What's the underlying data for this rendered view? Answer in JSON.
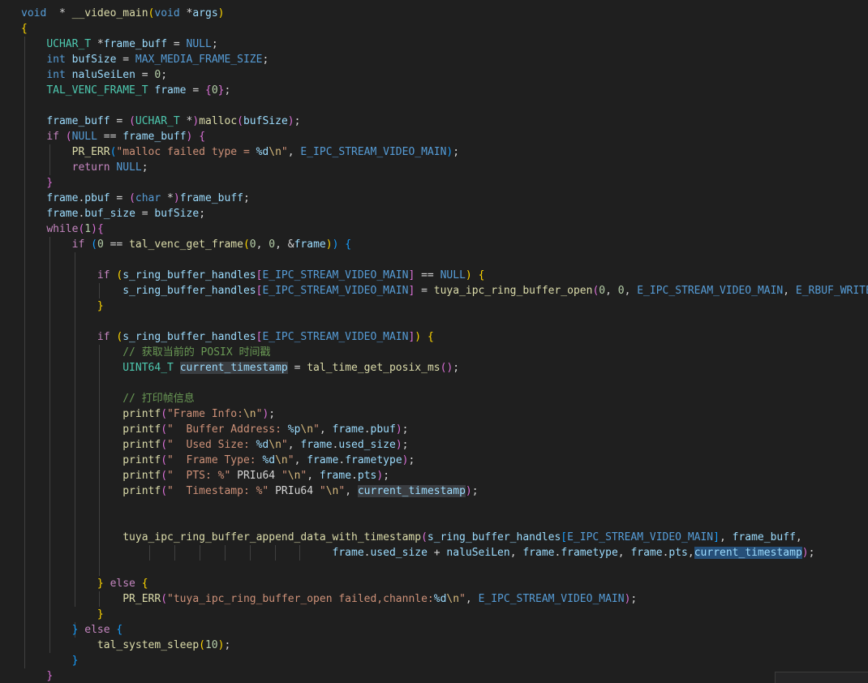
{
  "editor": {
    "lines": [
      [
        [
          "tok-kw",
          "void"
        ],
        [
          "",
          "  * "
        ],
        [
          "tok-func",
          "__video_main"
        ],
        [
          "tok-b1",
          "("
        ],
        [
          "tok-kw",
          "void"
        ],
        [
          "",
          " *"
        ],
        [
          "tok-var",
          "args"
        ],
        [
          "tok-b1",
          ")"
        ]
      ],
      [
        [
          "tok-b1",
          "{"
        ]
      ],
      [
        [
          "",
          "    "
        ],
        [
          "tok-type",
          "UCHAR_T"
        ],
        [
          "",
          " *"
        ],
        [
          "tok-var",
          "frame_buff"
        ],
        [
          "",
          " = "
        ],
        [
          "tok-kw",
          "NULL"
        ],
        [
          "",
          ";"
        ]
      ],
      [
        [
          "",
          "    "
        ],
        [
          "tok-kw",
          "int"
        ],
        [
          "",
          "",
          " "
        ],
        [
          "tok-var",
          "bufSize"
        ],
        [
          "",
          " = "
        ],
        [
          "tok-kw",
          "MAX_MEDIA_FRAME_SIZE"
        ],
        [
          "",
          ";"
        ]
      ],
      [
        [
          "",
          "    "
        ],
        [
          "tok-kw",
          "int"
        ],
        [
          "",
          " "
        ],
        [
          "tok-var",
          "naluSeiLen"
        ],
        [
          "",
          " = "
        ],
        [
          "tok-num",
          "0"
        ],
        [
          "",
          ";"
        ]
      ],
      [
        [
          "",
          "    "
        ],
        [
          "tok-type",
          "TAL_VENC_FRAME_T"
        ],
        [
          "",
          " "
        ],
        [
          "tok-var",
          "frame"
        ],
        [
          "",
          " = "
        ],
        [
          "tok-b2",
          "{"
        ],
        [
          "tok-num",
          "0"
        ],
        [
          "tok-b2",
          "}"
        ],
        [
          "",
          ";"
        ]
      ],
      [],
      [
        [
          "",
          "    "
        ],
        [
          "tok-var",
          "frame_buff"
        ],
        [
          "",
          " = "
        ],
        [
          "tok-b2",
          "("
        ],
        [
          "tok-type",
          "UCHAR_T"
        ],
        [
          "",
          " *"
        ],
        [
          "tok-b2",
          ")"
        ],
        [
          "tok-func",
          "malloc"
        ],
        [
          "tok-b2",
          "("
        ],
        [
          "tok-var",
          "bufSize"
        ],
        [
          "tok-b2",
          ")"
        ],
        [
          "",
          ";"
        ]
      ],
      [
        [
          "",
          "    "
        ],
        [
          "tok-ctrl",
          "if"
        ],
        [
          "",
          " "
        ],
        [
          "tok-b2",
          "("
        ],
        [
          "tok-kw",
          "NULL"
        ],
        [
          "",
          " == "
        ],
        [
          "tok-var",
          "frame_buff"
        ],
        [
          "tok-b2",
          ")"
        ],
        [
          "",
          " "
        ],
        [
          "tok-b2",
          "{"
        ]
      ],
      [
        [
          "",
          "        "
        ],
        [
          "tok-func",
          "PR_ERR"
        ],
        [
          "tok-b3",
          "("
        ],
        [
          "tok-str",
          "\"malloc failed type = "
        ],
        [
          "tok-fmt",
          "%d"
        ],
        [
          "tok-esc",
          "\\n"
        ],
        [
          "tok-str",
          "\""
        ],
        [
          "",
          ", "
        ],
        [
          "tok-kw",
          "E_IPC_STREAM_VIDEO_MAIN"
        ],
        [
          "tok-b3",
          ")"
        ],
        [
          "",
          ";"
        ]
      ],
      [
        [
          "",
          "        "
        ],
        [
          "tok-ctrl",
          "return"
        ],
        [
          "",
          " "
        ],
        [
          "tok-kw",
          "NULL"
        ],
        [
          "",
          ";"
        ]
      ],
      [
        [
          "",
          "    "
        ],
        [
          "tok-b2",
          "}"
        ]
      ],
      [
        [
          "",
          "    "
        ],
        [
          "tok-var",
          "frame"
        ],
        [
          "",
          "."
        ],
        [
          "tok-var",
          "pbuf"
        ],
        [
          "",
          " = "
        ],
        [
          "tok-b2",
          "("
        ],
        [
          "tok-kw",
          "char"
        ],
        [
          "",
          " *"
        ],
        [
          "tok-b2",
          ")"
        ],
        [
          "tok-var",
          "frame_buff"
        ],
        [
          "",
          ";"
        ]
      ],
      [
        [
          "",
          "    "
        ],
        [
          "tok-var",
          "frame"
        ],
        [
          "",
          "."
        ],
        [
          "tok-var",
          "buf_size"
        ],
        [
          "",
          " = "
        ],
        [
          "tok-var",
          "bufSize"
        ],
        [
          "",
          ";"
        ]
      ],
      [
        [
          "",
          "    "
        ],
        [
          "tok-ctrl",
          "while"
        ],
        [
          "tok-b2",
          "("
        ],
        [
          "tok-num",
          "1"
        ],
        [
          "tok-b2",
          ")"
        ],
        [
          "tok-b2",
          "{"
        ]
      ],
      [
        [
          "",
          "        "
        ],
        [
          "tok-ctrl",
          "if"
        ],
        [
          "",
          " "
        ],
        [
          "tok-b3",
          "("
        ],
        [
          "tok-num",
          "0"
        ],
        [
          "",
          " == "
        ],
        [
          "tok-func",
          "tal_venc_get_frame"
        ],
        [
          "tok-b1",
          "("
        ],
        [
          "tok-num",
          "0"
        ],
        [
          "",
          ", "
        ],
        [
          "tok-num",
          "0"
        ],
        [
          "",
          ", &"
        ],
        [
          "tok-var",
          "frame"
        ],
        [
          "tok-b1",
          ")"
        ],
        [
          "tok-b3",
          ")"
        ],
        [
          "",
          " "
        ],
        [
          "tok-b3",
          "{"
        ]
      ],
      [],
      [
        [
          "",
          "            "
        ],
        [
          "tok-ctrl",
          "if"
        ],
        [
          "",
          " "
        ],
        [
          "tok-b1",
          "("
        ],
        [
          "tok-var",
          "s_ring_buffer_handles"
        ],
        [
          "tok-b2",
          "["
        ],
        [
          "tok-kw",
          "E_IPC_STREAM_VIDEO_MAIN"
        ],
        [
          "tok-b2",
          "]"
        ],
        [
          "",
          " == "
        ],
        [
          "tok-kw",
          "NULL"
        ],
        [
          "tok-b1",
          ")"
        ],
        [
          "",
          " "
        ],
        [
          "tok-b1",
          "{"
        ]
      ],
      [
        [
          "",
          "                "
        ],
        [
          "tok-var",
          "s_ring_buffer_handles"
        ],
        [
          "tok-b2",
          "["
        ],
        [
          "tok-kw",
          "E_IPC_STREAM_VIDEO_MAIN"
        ],
        [
          "tok-b2",
          "]"
        ],
        [
          "",
          " = "
        ],
        [
          "tok-func",
          "tuya_ipc_ring_buffer_open"
        ],
        [
          "tok-b2",
          "("
        ],
        [
          "tok-num",
          "0"
        ],
        [
          "",
          ", "
        ],
        [
          "tok-num",
          "0"
        ],
        [
          "",
          ", "
        ],
        [
          "tok-kw",
          "E_IPC_STREAM_VIDEO_MAIN"
        ],
        [
          "",
          ", "
        ],
        [
          "tok-kw",
          "E_RBUF_WRITE"
        ],
        [
          "tok-b2",
          ")"
        ],
        [
          "",
          ";"
        ]
      ],
      [
        [
          "",
          "            "
        ],
        [
          "tok-b1",
          "}"
        ]
      ],
      [],
      [
        [
          "",
          "            "
        ],
        [
          "tok-ctrl",
          "if"
        ],
        [
          "",
          " "
        ],
        [
          "tok-b1",
          "("
        ],
        [
          "tok-var",
          "s_ring_buffer_handles"
        ],
        [
          "tok-b2",
          "["
        ],
        [
          "tok-kw",
          "E_IPC_STREAM_VIDEO_MAIN"
        ],
        [
          "tok-b2",
          "]"
        ],
        [
          "tok-b1",
          ")"
        ],
        [
          "",
          " "
        ],
        [
          "tok-b1",
          "{"
        ]
      ],
      [
        [
          "",
          "                "
        ],
        [
          "tok-cmt",
          "// 获取当前的 POSIX 时间戳"
        ]
      ],
      [
        [
          "",
          "                "
        ],
        [
          "tok-type",
          "UINT64_T"
        ],
        [
          "",
          " "
        ],
        [
          "tok-var tok-hl",
          "current_timestamp"
        ],
        [
          "",
          " = "
        ],
        [
          "tok-func",
          "tal_time_get_posix_ms"
        ],
        [
          "tok-b2",
          "("
        ],
        [
          "tok-b2",
          ")"
        ],
        [
          "",
          ";"
        ]
      ],
      [],
      [
        [
          "",
          "                "
        ],
        [
          "tok-cmt",
          "// 打印帧信息"
        ]
      ],
      [
        [
          "",
          "                "
        ],
        [
          "tok-func",
          "printf"
        ],
        [
          "tok-b2",
          "("
        ],
        [
          "tok-str",
          "\"Frame Info:"
        ],
        [
          "tok-esc",
          "\\n"
        ],
        [
          "tok-str",
          "\""
        ],
        [
          "tok-b2",
          ")"
        ],
        [
          "",
          ";"
        ]
      ],
      [
        [
          "",
          "                "
        ],
        [
          "tok-func",
          "printf"
        ],
        [
          "tok-b2",
          "("
        ],
        [
          "tok-str",
          "\"  Buffer Address: "
        ],
        [
          "tok-fmt",
          "%p"
        ],
        [
          "tok-esc",
          "\\n"
        ],
        [
          "tok-str",
          "\""
        ],
        [
          "",
          ", "
        ],
        [
          "tok-var",
          "frame"
        ],
        [
          "",
          "."
        ],
        [
          "tok-var",
          "pbuf"
        ],
        [
          "tok-b2",
          ")"
        ],
        [
          "",
          ";"
        ]
      ],
      [
        [
          "",
          "                "
        ],
        [
          "tok-func",
          "printf"
        ],
        [
          "tok-b2",
          "("
        ],
        [
          "tok-str",
          "\"  Used Size: "
        ],
        [
          "tok-fmt",
          "%d"
        ],
        [
          "tok-esc",
          "\\n"
        ],
        [
          "tok-str",
          "\""
        ],
        [
          "",
          ", "
        ],
        [
          "tok-var",
          "frame"
        ],
        [
          "",
          "."
        ],
        [
          "tok-var",
          "used_size"
        ],
        [
          "tok-b2",
          ")"
        ],
        [
          "",
          ";"
        ]
      ],
      [
        [
          "",
          "                "
        ],
        [
          "tok-func",
          "printf"
        ],
        [
          "tok-b2",
          "("
        ],
        [
          "tok-str",
          "\"  Frame Type: "
        ],
        [
          "tok-fmt",
          "%d"
        ],
        [
          "tok-esc",
          "\\n"
        ],
        [
          "tok-str",
          "\""
        ],
        [
          "",
          ", "
        ],
        [
          "tok-var",
          "frame"
        ],
        [
          "",
          "."
        ],
        [
          "tok-var",
          "frametype"
        ],
        [
          "tok-b2",
          ")"
        ],
        [
          "",
          ";"
        ]
      ],
      [
        [
          "",
          "                "
        ],
        [
          "tok-func",
          "printf"
        ],
        [
          "tok-b2",
          "("
        ],
        [
          "tok-str",
          "\"  PTS: %\""
        ],
        [
          "",
          " PRIu64 "
        ],
        [
          "tok-str",
          "\""
        ],
        [
          "tok-esc",
          "\\n"
        ],
        [
          "tok-str",
          "\""
        ],
        [
          "",
          ", "
        ],
        [
          "tok-var",
          "frame"
        ],
        [
          "",
          "."
        ],
        [
          "tok-var",
          "pts"
        ],
        [
          "tok-b2",
          ")"
        ],
        [
          "",
          ";"
        ]
      ],
      [
        [
          "",
          "                "
        ],
        [
          "tok-func",
          "printf"
        ],
        [
          "tok-b2",
          "("
        ],
        [
          "tok-str",
          "\"  Timestamp: %\""
        ],
        [
          "",
          " PRIu64 "
        ],
        [
          "tok-str",
          "\""
        ],
        [
          "tok-esc",
          "\\n"
        ],
        [
          "tok-str",
          "\""
        ],
        [
          "",
          ", "
        ],
        [
          "tok-var tok-hl",
          "current_timestamp"
        ],
        [
          "tok-b2",
          ")"
        ],
        [
          "",
          ";"
        ]
      ],
      [],
      [],
      [
        [
          "",
          "                "
        ],
        [
          "tok-func",
          "tuya_ipc_ring_buffer_append_data_with_timestamp"
        ],
        [
          "tok-b2",
          "("
        ],
        [
          "tok-var",
          "s_ring_buffer_handles"
        ],
        [
          "tok-b3",
          "["
        ],
        [
          "tok-kw",
          "E_IPC_STREAM_VIDEO_MAIN"
        ],
        [
          "tok-b3",
          "]"
        ],
        [
          "",
          ", "
        ],
        [
          "tok-var",
          "frame_buff"
        ],
        [
          "",
          ","
        ]
      ],
      [
        [
          "",
          "                                                 "
        ],
        [
          "tok-var",
          "frame"
        ],
        [
          "",
          "."
        ],
        [
          "tok-var",
          "used_size"
        ],
        [
          "",
          " + "
        ],
        [
          "tok-var",
          "naluSeiLen"
        ],
        [
          "",
          ", "
        ],
        [
          "tok-var",
          "frame"
        ],
        [
          "",
          "."
        ],
        [
          "tok-var",
          "frametype"
        ],
        [
          "",
          ", "
        ],
        [
          "tok-var",
          "frame"
        ],
        [
          "",
          "."
        ],
        [
          "tok-var",
          "pts"
        ],
        [
          "",
          ","
        ],
        [
          "tok-var tok-sel",
          "current_timestamp"
        ],
        [
          "tok-b2",
          ")"
        ],
        [
          "",
          ";"
        ]
      ],
      [],
      [
        [
          "",
          "            "
        ],
        [
          "tok-b1",
          "}"
        ],
        [
          "",
          " "
        ],
        [
          "tok-ctrl",
          "else"
        ],
        [
          "",
          " "
        ],
        [
          "tok-b1",
          "{"
        ]
      ],
      [
        [
          "",
          "                "
        ],
        [
          "tok-func",
          "PR_ERR"
        ],
        [
          "tok-b2",
          "("
        ],
        [
          "tok-str",
          "\"tuya_ipc_ring_buffer_open failed,channle:"
        ],
        [
          "tok-fmt",
          "%d"
        ],
        [
          "tok-esc",
          "\\n"
        ],
        [
          "tok-str",
          "\""
        ],
        [
          "",
          ", "
        ],
        [
          "tok-kw",
          "E_IPC_STREAM_VIDEO_MAIN"
        ],
        [
          "tok-b2",
          ")"
        ],
        [
          "",
          ";"
        ]
      ],
      [
        [
          "",
          "            "
        ],
        [
          "tok-b1",
          "}"
        ]
      ],
      [
        [
          "",
          "        "
        ],
        [
          "tok-b3",
          "}"
        ],
        [
          "",
          " "
        ],
        [
          "tok-ctrl",
          "else"
        ],
        [
          "",
          " "
        ],
        [
          "tok-b3",
          "{"
        ]
      ],
      [
        [
          "",
          "            "
        ],
        [
          "tok-func",
          "tal_system_sleep"
        ],
        [
          "tok-b1",
          "("
        ],
        [
          "tok-num",
          "10"
        ],
        [
          "tok-b1",
          ")"
        ],
        [
          "",
          ";"
        ]
      ],
      [
        [
          "",
          "        "
        ],
        [
          "tok-b3",
          "}"
        ]
      ],
      [
        [
          "",
          "    "
        ],
        [
          "tok-b2",
          "}"
        ]
      ]
    ]
  }
}
